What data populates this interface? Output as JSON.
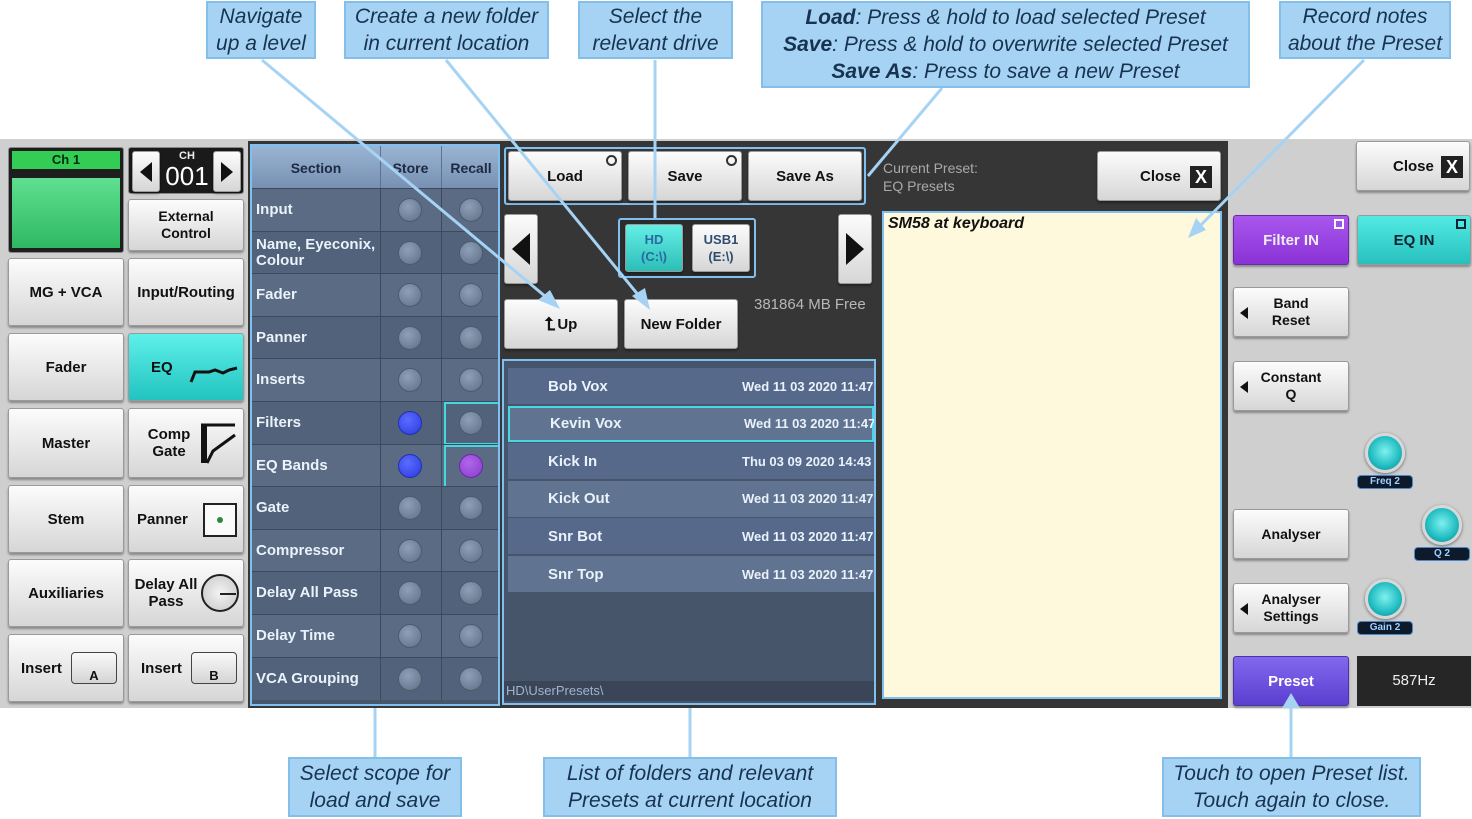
{
  "callouts": {
    "up": "Navigate up a level",
    "new_folder": "Create a new folder in current location",
    "drive": "Select the relevant drive",
    "load_b": "Load",
    "load_t": ": Press & hold to load selected Preset",
    "save_b": "Save",
    "save_t": ": Press & hold to overwrite selected Preset",
    "saveas_b": "Save As",
    "saveas_t": ": Press to save a new Preset",
    "notes": "Record notes about the Preset",
    "scope": "Select scope for load and save",
    "list": "List of folders and relevant Presets at current location",
    "preset_open": "Touch to open Preset list. Touch again to close."
  },
  "left": {
    "ch_label": "Ch 1",
    "ch_small": "CH",
    "ch_number": "001",
    "external_control": "External Control",
    "mg_vca": "MG + VCA",
    "input_routing": "Input/Routing",
    "fader": "Fader",
    "eq": "EQ",
    "master": "Master",
    "comp_gate": "Comp Gate",
    "stem": "Stem",
    "panner": "Panner",
    "auxiliaries": "Auxiliaries",
    "delay": "Delay All Pass",
    "insert_a": "Insert",
    "insert_a_tag": "A",
    "insert_b": "Insert",
    "insert_b_tag": "B"
  },
  "section": {
    "headers": [
      "Section",
      "Store",
      "Recall"
    ],
    "rows": [
      {
        "label": "Input",
        "store": false,
        "recall": false
      },
      {
        "label": "Name, Eyeconix, Colour",
        "store": false,
        "recall": false
      },
      {
        "label": "Fader",
        "store": false,
        "recall": false
      },
      {
        "label": "Panner",
        "store": false,
        "recall": false
      },
      {
        "label": "Inserts",
        "store": false,
        "recall": false
      },
      {
        "label": "Filters",
        "store": true,
        "recall": false
      },
      {
        "label": "EQ Bands",
        "store": true,
        "recall": true
      },
      {
        "label": "Gate",
        "store": false,
        "recall": false
      },
      {
        "label": "Compressor",
        "store": false,
        "recall": false
      },
      {
        "label": "Delay All Pass",
        "store": false,
        "recall": false
      },
      {
        "label": "Delay Time",
        "store": false,
        "recall": false
      },
      {
        "label": "VCA Grouping",
        "store": false,
        "recall": false
      }
    ]
  },
  "browser": {
    "load": "Load",
    "save": "Save",
    "save_as": "Save As",
    "drive_hd": "HD",
    "drive_hd_path": "(C:\\)",
    "drive_usb": "USB1",
    "drive_usb_path": "(E:\\)",
    "up": "Up",
    "new_folder": "New Folder",
    "free": "381864 MB Free",
    "path": "HD\\UserPresets\\",
    "files": [
      {
        "name": "Bob Vox",
        "date": "Wed 11 03 2020 11:47"
      },
      {
        "name": "Kevin Vox",
        "date": "Wed 11 03 2020 11:47"
      },
      {
        "name": "Kick In",
        "date": "Thu 03 09 2020 14:43"
      },
      {
        "name": "Kick Out",
        "date": "Wed 11 03 2020 11:47"
      },
      {
        "name": "Snr Bot",
        "date": "Wed 11 03 2020 11:47"
      },
      {
        "name": "Snr Top",
        "date": "Wed 11 03 2020 11:47"
      }
    ],
    "selected_index": 1
  },
  "notes": {
    "current_label": "Current Preset:",
    "current_value": "EQ Presets",
    "close": "Close",
    "text": "SM58 at keyboard"
  },
  "right": {
    "close": "Close",
    "filter_in": "Filter IN",
    "eq_in": "EQ IN",
    "band_reset": "Band Reset",
    "constant_q": "Constant Q",
    "analyser": "Analyser",
    "analyser_settings": "Analyser Settings",
    "preset": "Preset",
    "freq_readout": "587Hz",
    "knob_freq": "Freq 2",
    "knob_q": "Q 2",
    "knob_gain": "Gain 2"
  },
  "colors": {
    "accent_cyan": "#34d7d3",
    "filter_purple": "#9b3fe0",
    "preset_purple": "#7556e0",
    "callout": "#a6d3f4"
  }
}
